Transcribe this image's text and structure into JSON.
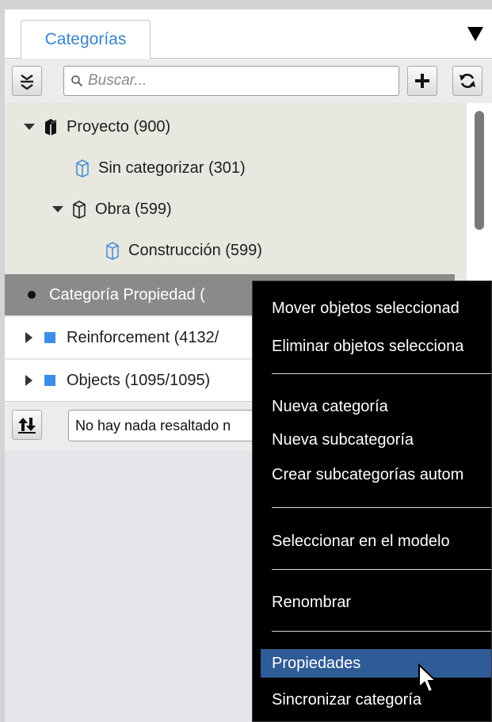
{
  "panel": {
    "tab_label": "Categorías"
  },
  "toolbar": {
    "search_placeholder": "Buscar..."
  },
  "tree": {
    "items": [
      {
        "label": "Proyecto (900)"
      },
      {
        "label": "Sin categorizar (301)"
      },
      {
        "label": "Obra (599)"
      },
      {
        "label": "Construcción (599)"
      },
      {
        "label": "Categoría Propiedad ("
      },
      {
        "label": "Reinforcement (4132/"
      },
      {
        "label": "Objects (1095/1095)"
      }
    ]
  },
  "bottom": {
    "highlight_text": "No hay nada resaltado n"
  },
  "context_menu": {
    "items": [
      {
        "label": "Mover objetos seleccionad"
      },
      {
        "label": "Eliminar objetos selecciona"
      },
      {
        "label": "Nueva categoría"
      },
      {
        "label": "Nueva subcategoría"
      },
      {
        "label": "Crear subcategorías autom"
      },
      {
        "label": "Seleccionar en el modelo"
      },
      {
        "label": "Renombrar"
      },
      {
        "label": "Propiedades"
      },
      {
        "label": "Sincronizar categoría"
      }
    ]
  },
  "colors": {
    "accent": "#3a84c8",
    "selected_row": "#8a8a8a",
    "menu_highlight": "#2f5b96",
    "category_icon": "#3b8fe6"
  }
}
